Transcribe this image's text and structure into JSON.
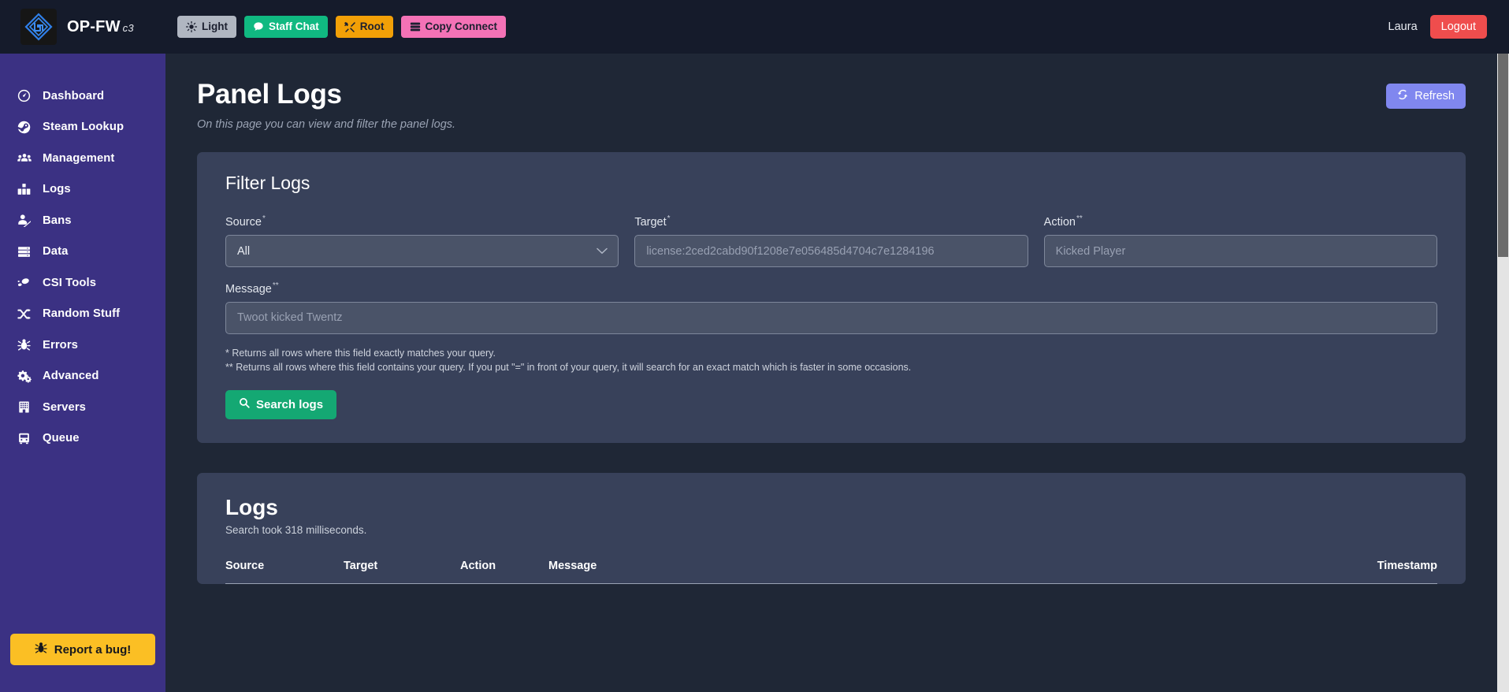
{
  "brand": {
    "name": "OP-FW",
    "version": "c3",
    "logo_icon": "op-fw-logo-icon"
  },
  "topbar": {
    "buttons": [
      {
        "label": "Light",
        "icon": "sun-icon",
        "color": "#b0b6c1"
      },
      {
        "label": "Staff Chat",
        "icon": "chat-bubble-icon",
        "color": "#10b981"
      },
      {
        "label": "Root",
        "icon": "tools-icon",
        "color": "#f2a007"
      },
      {
        "label": "Copy Connect",
        "icon": "server-icon",
        "color": "#f472b6"
      }
    ],
    "username": "Laura",
    "logout_label": "Logout",
    "logout_color": "#ef4d4d"
  },
  "sidebar": {
    "items": [
      {
        "label": "Dashboard",
        "icon": "gauge-icon"
      },
      {
        "label": "Steam Lookup",
        "icon": "steam-icon"
      },
      {
        "label": "Management",
        "icon": "users-icon"
      },
      {
        "label": "Logs",
        "icon": "chart-bars-icon"
      },
      {
        "label": "Bans",
        "icon": "user-slash-icon"
      },
      {
        "label": "Data",
        "icon": "database-icon"
      },
      {
        "label": "CSI Tools",
        "icon": "footprints-icon"
      },
      {
        "label": "Random Stuff",
        "icon": "shuffle-icon"
      },
      {
        "label": "Errors",
        "icon": "bug-icon"
      },
      {
        "label": "Advanced",
        "icon": "gears-icon"
      },
      {
        "label": "Servers",
        "icon": "building-icon"
      },
      {
        "label": "Queue",
        "icon": "tram-icon"
      }
    ],
    "report_bug_label": "Report a bug!",
    "report_bug_icon": "bug-icon",
    "background_color": "#3b3183",
    "report_bug_color": "#fbbf24"
  },
  "page": {
    "title": "Panel Logs",
    "subtitle": "On this page you can view and filter the panel logs.",
    "refresh_label": "Refresh",
    "refresh_icon": "refresh-icon",
    "refresh_color": "#8087ef"
  },
  "filter": {
    "card_title": "Filter Logs",
    "source": {
      "label": "Source",
      "marker": "*",
      "value": "All",
      "options": [
        "All"
      ]
    },
    "target": {
      "label": "Target",
      "marker": "*",
      "value": "",
      "placeholder": "license:2ced2cabd90f1208e7e056485d4704c7e1284196"
    },
    "action": {
      "label": "Action",
      "marker": "**",
      "value": "",
      "placeholder": "Kicked Player"
    },
    "message": {
      "label": "Message",
      "marker": "**",
      "value": "",
      "placeholder": "Twoot kicked Twentz"
    },
    "hint_one": "* Returns all rows where this field exactly matches your query.",
    "hint_two": "** Returns all rows where this field contains your query. If you put \"=\" in front of your query, it will search for an exact match which is faster in some occasions.",
    "search_label": "Search logs",
    "search_icon": "magnifier-icon",
    "search_color": "#14a873"
  },
  "logs": {
    "title": "Logs",
    "subtitle": "Search took 318 milliseconds.",
    "columns": [
      {
        "key": "source",
        "label": "Source"
      },
      {
        "key": "target",
        "label": "Target"
      },
      {
        "key": "action",
        "label": "Action"
      },
      {
        "key": "message",
        "label": "Message"
      },
      {
        "key": "timestamp",
        "label": "Timestamp"
      }
    ],
    "rows": []
  }
}
